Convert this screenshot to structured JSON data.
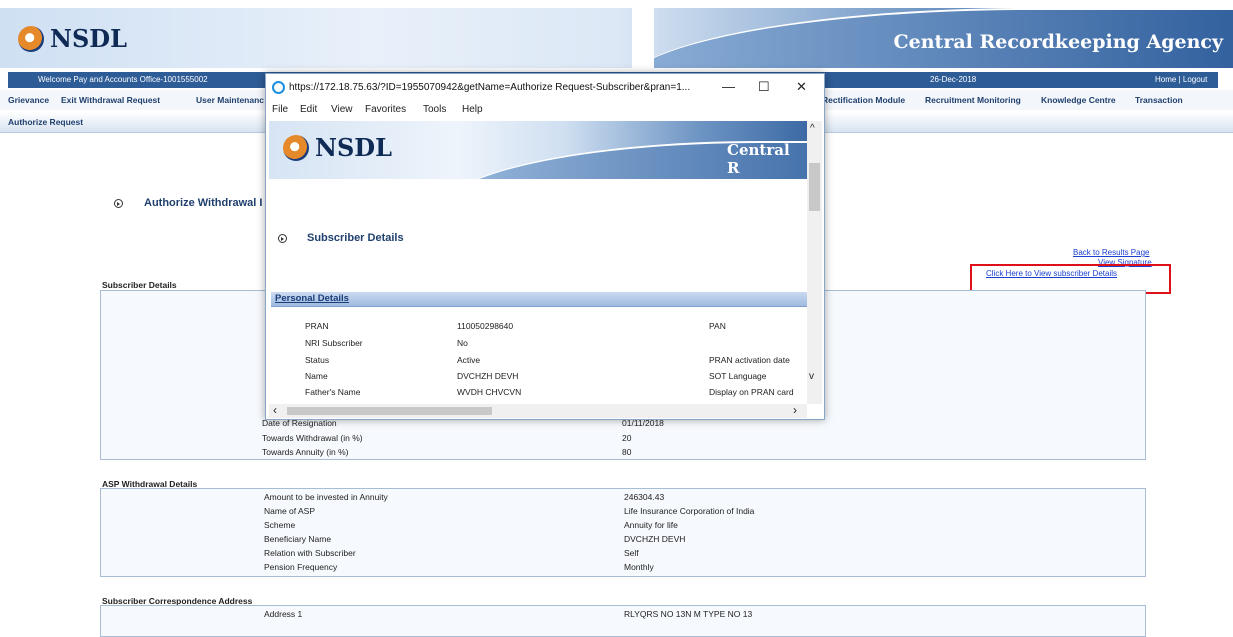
{
  "header": {
    "logo_text": "NSDL",
    "agency": "Central Recordkeeping Agency"
  },
  "topbar": {
    "welcome": "Welcome Pay and Accounts Office-1001555002",
    "date": "26-Dec-2018",
    "home_logout": "Home | Logout"
  },
  "nav": {
    "left_items": [
      "Grievance",
      "Exit Withdrawal Request",
      "User Maintenanc"
    ],
    "right_items": [
      "Rectification Module",
      "Recruitment Monitoring",
      "Knowledge Centre",
      "Transaction"
    ],
    "sub": "Authorize Request"
  },
  "page": {
    "title": "Authorize Withdrawal I",
    "links": {
      "back": "Back to Results Page",
      "signature": "View Signature",
      "subscriber": "Click Here to View subscriber Details"
    }
  },
  "subscriber_details": {
    "label": "Subscriber Details",
    "rows": [
      {
        "label": "Date of Resignation",
        "value": "01/11/2018"
      },
      {
        "label": "Towards Withdrawal (in %)",
        "value": "20"
      },
      {
        "label": "Towards Annuity (in %)",
        "value": "80"
      }
    ]
  },
  "asp_details": {
    "label": "ASP Withdrawal Details",
    "rows": [
      {
        "label": "Amount to be invested in Annuity",
        "value": "246304.43"
      },
      {
        "label": "Name of ASP",
        "value": "Life Insurance Corporation of India"
      },
      {
        "label": "Scheme",
        "value": "Annuity for life"
      },
      {
        "label": "Beneficiary Name",
        "value": "DVCHZH DEVH"
      },
      {
        "label": "Relation with Subscriber",
        "value": "Self"
      },
      {
        "label": "Pension Frequency",
        "value": "Monthly"
      }
    ]
  },
  "correspondence": {
    "label": "Subscriber Correspondence Address",
    "rows": [
      {
        "label": "Address 1",
        "value": "RLYQRS NO 13N M TYPE NO 13"
      }
    ]
  },
  "popup": {
    "url": "https://172.18.75.63/?ID=1955070942&getName=Authorize Request-Subscriber&pran=1...",
    "controls": {
      "minimize": "—",
      "maximize": "☐",
      "close": "✕"
    },
    "menu": [
      "File",
      "Edit",
      "View",
      "Favorites",
      "Tools",
      "Help"
    ],
    "header_logo": "NSDL",
    "header_right": "Central R",
    "section_title": "Subscriber Details",
    "personal_details": "Personal Details",
    "rows": [
      {
        "label": "PRAN",
        "value": "110050298640",
        "right": "PAN"
      },
      {
        "label": "NRI Subscriber",
        "value": "No",
        "right": ""
      },
      {
        "label": "Status",
        "value": "Active",
        "right": "PRAN activation date"
      },
      {
        "label": "Name",
        "value": "DVCHZH DEVH",
        "right": "SOT Language"
      },
      {
        "label": "Father's Name",
        "value": "WVDH CHVCVN",
        "right": "Display on PRAN card"
      }
    ]
  }
}
